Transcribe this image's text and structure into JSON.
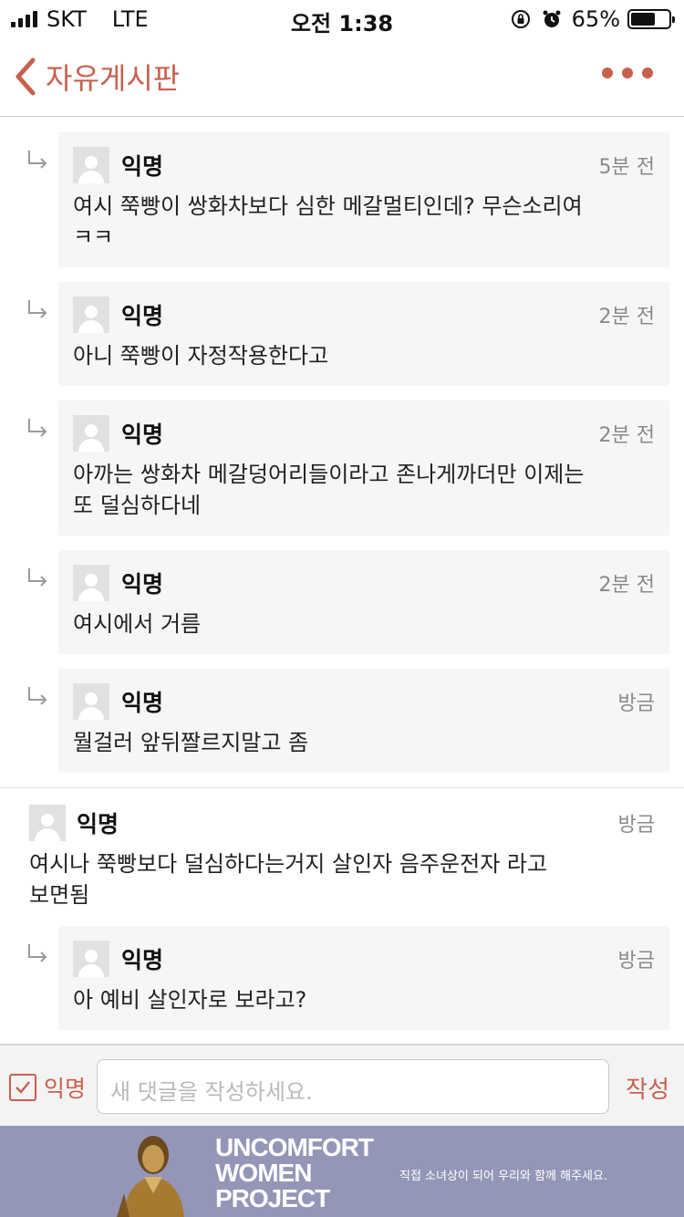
{
  "status_bar": {
    "carrier": "SKT",
    "network": "LTE",
    "time": "오전 1:38",
    "battery": "65%",
    "battery_level": 0.65
  },
  "nav": {
    "title": "자유게시판",
    "back_icon": "chevron-left-icon",
    "more_icon": "more-dots-icon"
  },
  "comments": [
    {
      "type": "reply",
      "author": "익명",
      "time": "5분 전",
      "lines": [
        "여시 쭉빵이 쌍화차보다 심한 메갈멀티인데? 무슨소리여",
        "ㅋㅋ"
      ]
    },
    {
      "type": "reply",
      "author": "익명",
      "time": "2분 전",
      "lines": [
        "아니 쭉빵이 자정작용한다고"
      ]
    },
    {
      "type": "reply",
      "author": "익명",
      "time": "2분 전",
      "lines": [
        "아까는 쌍화차 메갈덩어리들이라고 존나게까더만 이제는",
        "또 덜심하다네"
      ]
    },
    {
      "type": "reply",
      "author": "익명",
      "time": "2분 전",
      "lines": [
        "여시에서 거름"
      ]
    },
    {
      "type": "reply",
      "author": "익명",
      "time": "방금",
      "lines": [
        "뭘걸러 앞뒤짤르지말고 좀"
      ]
    },
    {
      "type": "comment",
      "author": "익명",
      "time": "방금",
      "lines": [
        "여시나 쭉빵보다 덜심하다는거지 살인자 음주운전자 라고",
        "보면됨"
      ]
    },
    {
      "type": "reply",
      "author": "익명",
      "time": "방금",
      "lines": [
        "아 예비 살인자로 보라고?"
      ]
    }
  ],
  "compose": {
    "anonymous_label": "익명",
    "anonymous_checked": true,
    "placeholder": "새 댓글을 작성하세요.",
    "submit_label": "작성"
  },
  "banner": {
    "title_lines": [
      "UNCOMFORT",
      "WOMEN",
      "PROJECT"
    ],
    "subtitle": "직접 소녀상이 되어 우리와 함께 해주세요.",
    "background_color": "#9496b8"
  },
  "colors": {
    "accent": "#c8604e",
    "reply_bg": "#f6f6f6"
  }
}
